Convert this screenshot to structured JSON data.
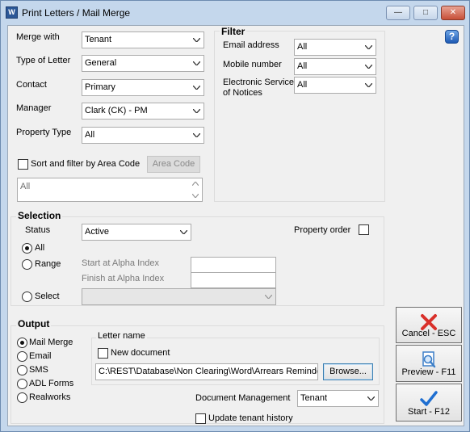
{
  "window": {
    "app_icon": "W",
    "title": "Print Letters / Mail Merge",
    "controls": {
      "minimize": "—",
      "maximize": "□",
      "close": "✕"
    }
  },
  "help": {
    "icon": "help-icon",
    "glyph": "?"
  },
  "criteria": {
    "merge_with": {
      "label": "Merge with",
      "value": "Tenant"
    },
    "type_of_letter": {
      "label": "Type of Letter",
      "value": "General"
    },
    "contact": {
      "label": "Contact",
      "value": "Primary"
    },
    "manager": {
      "label": "Manager",
      "value": "Clark (CK) - PM"
    },
    "property_type": {
      "label": "Property Type",
      "value": "All"
    },
    "sort_area_code": {
      "label": "Sort and filter by Area Code",
      "checked": false
    },
    "area_code_button": "Area Code",
    "area_list": [
      "All"
    ]
  },
  "filter": {
    "title": "Filter",
    "email": {
      "label": "Email address",
      "value": "All"
    },
    "mobile": {
      "label": "Mobile number",
      "value": "All"
    },
    "esn": {
      "label_line1": "Electronic Service",
      "label_line2": "of Notices",
      "value": "All"
    }
  },
  "selection": {
    "title": "Selection",
    "status": {
      "label": "Status",
      "value": "Active"
    },
    "property_order": {
      "label": "Property order",
      "checked": false
    },
    "options": [
      {
        "label": "All",
        "checked": true
      },
      {
        "label": "Range",
        "checked": false
      },
      {
        "label": "Select",
        "checked": false
      }
    ],
    "start_alpha": {
      "label": "Start at Alpha Index",
      "value": ""
    },
    "finish_alpha": {
      "label": "Finish at Alpha Index",
      "value": ""
    },
    "select_value": ""
  },
  "output": {
    "title": "Output",
    "options": [
      {
        "label": "Mail Merge",
        "checked": true
      },
      {
        "label": "Email",
        "checked": false
      },
      {
        "label": "SMS",
        "checked": false
      },
      {
        "label": "ADL Forms",
        "checked": false
      },
      {
        "label": "Realworks",
        "checked": false
      }
    ],
    "letter_name": {
      "title": "Letter name",
      "new_document": {
        "label": "New document",
        "checked": false
      },
      "path": "C:\\REST\\Database\\Non Clearing\\Word\\Arrears Reminder",
      "browse": "Browse..."
    },
    "document_management": {
      "label": "Document Management",
      "value": "Tenant"
    },
    "update_history": {
      "label": "Update tenant history",
      "checked": false
    }
  },
  "actions": {
    "cancel": {
      "label": "Cancel - ESC",
      "icon": "cancel-x-icon",
      "color": "#d9302a"
    },
    "preview": {
      "label": "Preview - F11",
      "icon": "preview-magnifier-icon",
      "color": "#3d7fc8"
    },
    "start": {
      "label": "Start - F12",
      "icon": "start-checkmark-icon",
      "color": "#1f6fd1"
    }
  }
}
